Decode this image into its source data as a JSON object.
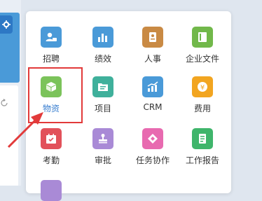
{
  "popup": {
    "apps": [
      {
        "label": "招聘",
        "color": "#4a9ad8",
        "icon": "person-tag-icon"
      },
      {
        "label": "绩效",
        "color": "#4a9ad8",
        "icon": "bar-chart-icon"
      },
      {
        "label": "人事",
        "color": "#c98a44",
        "icon": "id-badge-icon"
      },
      {
        "label": "企业文件",
        "color": "#71b84a",
        "icon": "book-icon"
      },
      {
        "label": "物资",
        "color": "#7bc35a",
        "icon": "cube-icon"
      },
      {
        "label": "项目",
        "color": "#3fb09b",
        "icon": "folder-icon"
      },
      {
        "label": "CRM",
        "color": "#4a9ad8",
        "icon": "trend-chart-icon"
      },
      {
        "label": "费用",
        "color": "#f2a520",
        "icon": "yen-coin-icon"
      },
      {
        "label": "考勤",
        "color": "#e2515a",
        "icon": "calendar-check-icon"
      },
      {
        "label": "审批",
        "color": "#a98ad6",
        "icon": "stamp-icon"
      },
      {
        "label": "任务协作",
        "color": "#e86ab0",
        "icon": "diamond-icon"
      },
      {
        "label": "工作报告",
        "color": "#3fb56b",
        "icon": "report-icon"
      }
    ],
    "highlighted": "物资"
  }
}
